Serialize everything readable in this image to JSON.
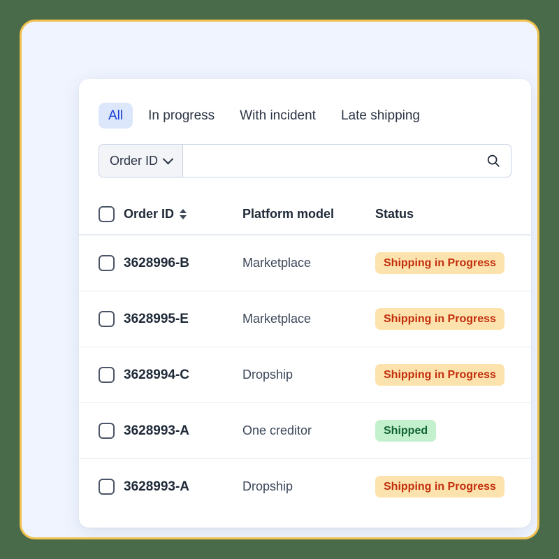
{
  "theme": {
    "page_background": "#4a6b4a",
    "frame_border": "#f2c251",
    "frame_background": "#eff4fe",
    "card_background": "#ffffff",
    "active_tab_bg": "#dde7fc",
    "active_tab_text": "#1a3fd4",
    "badge_progress_bg": "#fce3ae",
    "badge_progress_text": "#c22e0c",
    "badge_shipped_bg": "#c3f0cd",
    "badge_shipped_text": "#116336"
  },
  "tabs": [
    {
      "label": "All",
      "active": true
    },
    {
      "label": "In progress",
      "active": false
    },
    {
      "label": "With incident",
      "active": false
    },
    {
      "label": "Late shipping",
      "active": false
    }
  ],
  "search": {
    "selected_field": "Order ID",
    "dropdown_icon": "chevron-down-icon",
    "value": "",
    "placeholder": "",
    "search_icon": "search-icon"
  },
  "table": {
    "select_all_checkbox": "",
    "columns": [
      {
        "label": "Order ID",
        "sortable": true,
        "sort_icon": "sort-updown-icon"
      },
      {
        "label": "Platform model",
        "sortable": false
      },
      {
        "label": "Status",
        "sortable": false
      }
    ],
    "rows": [
      {
        "order_id": "3628996-B",
        "platform_model": "Marketplace",
        "status": "Shipping in Progress",
        "status_type": "progress",
        "checked": false
      },
      {
        "order_id": "3628995-E",
        "platform_model": "Marketplace",
        "status": "Shipping in Progress",
        "status_type": "progress",
        "checked": false
      },
      {
        "order_id": "3628994-C",
        "platform_model": "Dropship",
        "status": "Shipping in Progress",
        "status_type": "progress",
        "checked": false
      },
      {
        "order_id": "3628993-A",
        "platform_model": "One creditor",
        "status": "Shipped",
        "status_type": "shipped",
        "checked": false
      },
      {
        "order_id": "3628993-A",
        "platform_model": "Dropship",
        "status": "Shipping in Progress",
        "status_type": "progress",
        "checked": false
      }
    ]
  }
}
